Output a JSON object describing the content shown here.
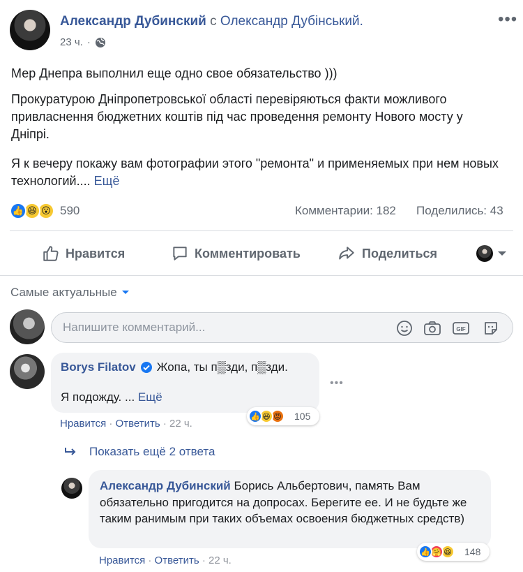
{
  "post": {
    "author": "Александр Дубинский",
    "with_word": "с",
    "tagged": "Олександр Дубінський.",
    "time": "23 ч.",
    "privacy_icon": "globe-icon",
    "paragraphs": [
      "Мер Днепра выполнил еще одно свое обязательство )))",
      "Прокуратурою Дніпропетровської області перевіряються факти можливого привласнення бюджетних коштів під час проведення ремонту Нового мосту у Дніпрі.",
      "Я к вечеру покажу вам фотографии этого \"ремонта\" и применяемых при нем новых технологий...."
    ],
    "see_more": "Ещё",
    "reaction_count": "590",
    "comments_count": "Комментарии: 182",
    "shares_count": "Поделились: 43"
  },
  "actions": {
    "like": "Нравится",
    "comment": "Комментировать",
    "share": "Поделиться"
  },
  "comments_section": {
    "sort_label": "Самые актуальные",
    "input_placeholder": "Напишите комментарий...",
    "show_more_replies": "Показать ещё 2 ответа"
  },
  "comments": [
    {
      "author": "Borys Filatov",
      "verified": true,
      "text_line1": "Жопа, ты п▒зди, п▒зди.",
      "text_line2": "Я подожду. ...",
      "see_more": "Ещё",
      "like": "Нравится",
      "reply": "Ответить",
      "time": "22 ч.",
      "reaction_count": "105"
    },
    {
      "author": "Александр Дубинский",
      "text": "Борись Альбертович, память Вам обязательно пригодится на допросах. Берегите ее. И не будьте же таким ранимым при таких объемах освоения бюджетных средств)",
      "like": "Нравится",
      "reply": "Ответить",
      "time": "22 ч.",
      "reaction_count": "148"
    }
  ],
  "colors": {
    "link": "#385898",
    "like_blue": "#1877f2",
    "muted": "#606770",
    "bubble": "#f2f3f5"
  }
}
